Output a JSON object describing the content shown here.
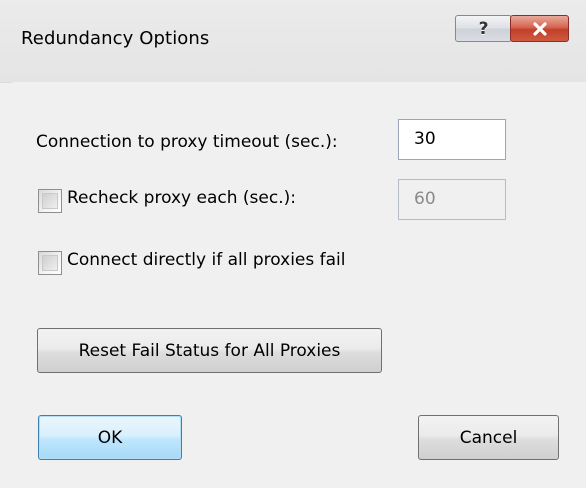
{
  "window": {
    "title": "Redundancy Options",
    "help_label": "?",
    "close_label": "close"
  },
  "timeout": {
    "label": "Connection to proxy timeout (sec.):",
    "value": "30"
  },
  "recheck": {
    "label": "Recheck proxy each (sec.):",
    "checked": false,
    "value": "60",
    "enabled": false
  },
  "direct": {
    "label": "Connect directly if all proxies fail",
    "checked": false
  },
  "buttons": {
    "reset_label": "Reset Fail Status for All Proxies",
    "ok_label": "OK",
    "cancel_label": "Cancel"
  },
  "icons": {
    "help": "help-icon",
    "close": "close-icon",
    "checkbox": "checkbox"
  },
  "colors": {
    "default_button_border": "#3c7fb1",
    "close_button": "#c1402b",
    "disabled_text": "#8a8a8a"
  }
}
